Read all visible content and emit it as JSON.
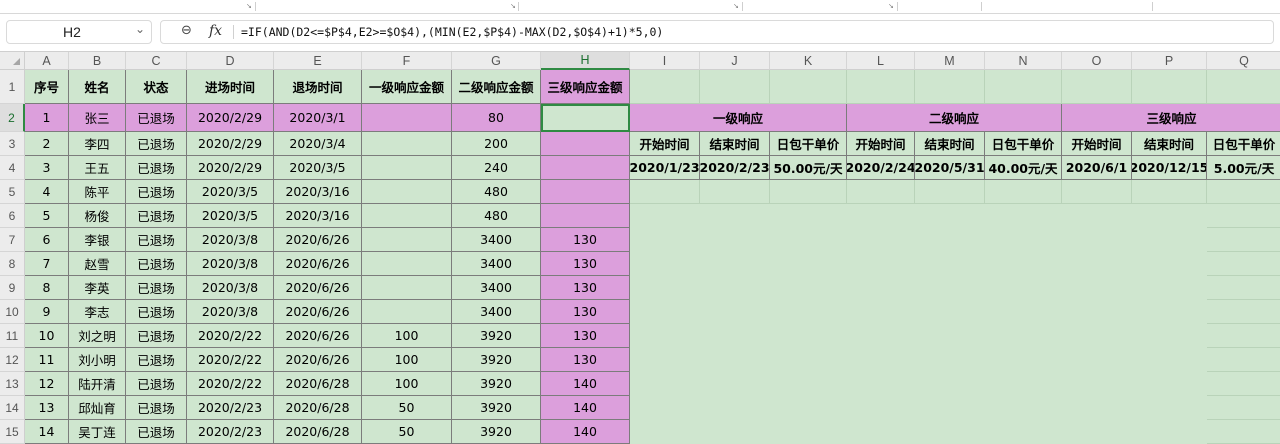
{
  "name_box": {
    "value": "H2"
  },
  "formula_bar": {
    "formula": "=IF(AND(D2<=$P$4,E2>=$O$4),(MIN(E2,$P$4)-MAX(D2,$O$4)+1)*5,0)"
  },
  "column_headers": [
    "A",
    "B",
    "C",
    "D",
    "E",
    "F",
    "G",
    "H",
    "I",
    "J",
    "K",
    "L",
    "M",
    "N",
    "O",
    "P",
    "Q"
  ],
  "row_numbers": [
    "1",
    "2",
    "3",
    "4",
    "5",
    "6",
    "7",
    "8",
    "9",
    "10",
    "11",
    "12",
    "13",
    "14",
    "15"
  ],
  "table": {
    "headers": [
      "序号",
      "姓名",
      "状态",
      "进场时间",
      "退场时间",
      "一级响应金额",
      "二级响应金额",
      "三级响应金额"
    ],
    "rows": [
      [
        "1",
        "张三",
        "已退场",
        "2020/2/29",
        "2020/3/1",
        "",
        "80",
        ""
      ],
      [
        "2",
        "李四",
        "已退场",
        "2020/2/29",
        "2020/3/4",
        "",
        "200",
        ""
      ],
      [
        "3",
        "王五",
        "已退场",
        "2020/2/29",
        "2020/3/5",
        "",
        "240",
        ""
      ],
      [
        "4",
        "陈平",
        "已退场",
        "2020/3/5",
        "2020/3/16",
        "",
        "480",
        ""
      ],
      [
        "5",
        "杨俊",
        "已退场",
        "2020/3/5",
        "2020/3/16",
        "",
        "480",
        ""
      ],
      [
        "6",
        "李银",
        "已退场",
        "2020/3/8",
        "2020/6/26",
        "",
        "3400",
        "130"
      ],
      [
        "7",
        "赵雪",
        "已退场",
        "2020/3/8",
        "2020/6/26",
        "",
        "3400",
        "130"
      ],
      [
        "8",
        "李英",
        "已退场",
        "2020/3/8",
        "2020/6/26",
        "",
        "3400",
        "130"
      ],
      [
        "9",
        "李志",
        "已退场",
        "2020/3/8",
        "2020/6/26",
        "",
        "3400",
        "130"
      ],
      [
        "10",
        "刘之明",
        "已退场",
        "2020/2/22",
        "2020/6/26",
        "100",
        "3920",
        "130"
      ],
      [
        "11",
        "刘小明",
        "已退场",
        "2020/2/22",
        "2020/6/26",
        "100",
        "3920",
        "130"
      ],
      [
        "12",
        "陆开清",
        "已退场",
        "2020/2/22",
        "2020/6/28",
        "100",
        "3920",
        "140"
      ],
      [
        "13",
        "邱灿育",
        "已退场",
        "2020/2/23",
        "2020/6/28",
        "50",
        "3920",
        "140"
      ],
      [
        "14",
        "吴丁连",
        "已退场",
        "2020/2/23",
        "2020/6/28",
        "50",
        "3920",
        "140"
      ]
    ]
  },
  "response_table": {
    "groups": [
      "一级响应",
      "二级响应",
      "三级响应"
    ],
    "subheaders": [
      "开始时间",
      "结束时间",
      "日包干单价",
      "开始时间",
      "结束时间",
      "日包干单价",
      "开始时间",
      "结束时间",
      "日包干单价"
    ],
    "values": [
      "2020/1/23",
      "2020/2/23",
      "50.00元/天",
      "2020/2/24",
      "2020/5/31",
      "40.00元/天",
      "2020/6/1",
      "2020/12/15",
      "5.00元/天"
    ]
  },
  "colors": {
    "sheet_bg": "#cfe6cf",
    "highlight": "#dc9fdc",
    "selection": "#2f8a43"
  }
}
